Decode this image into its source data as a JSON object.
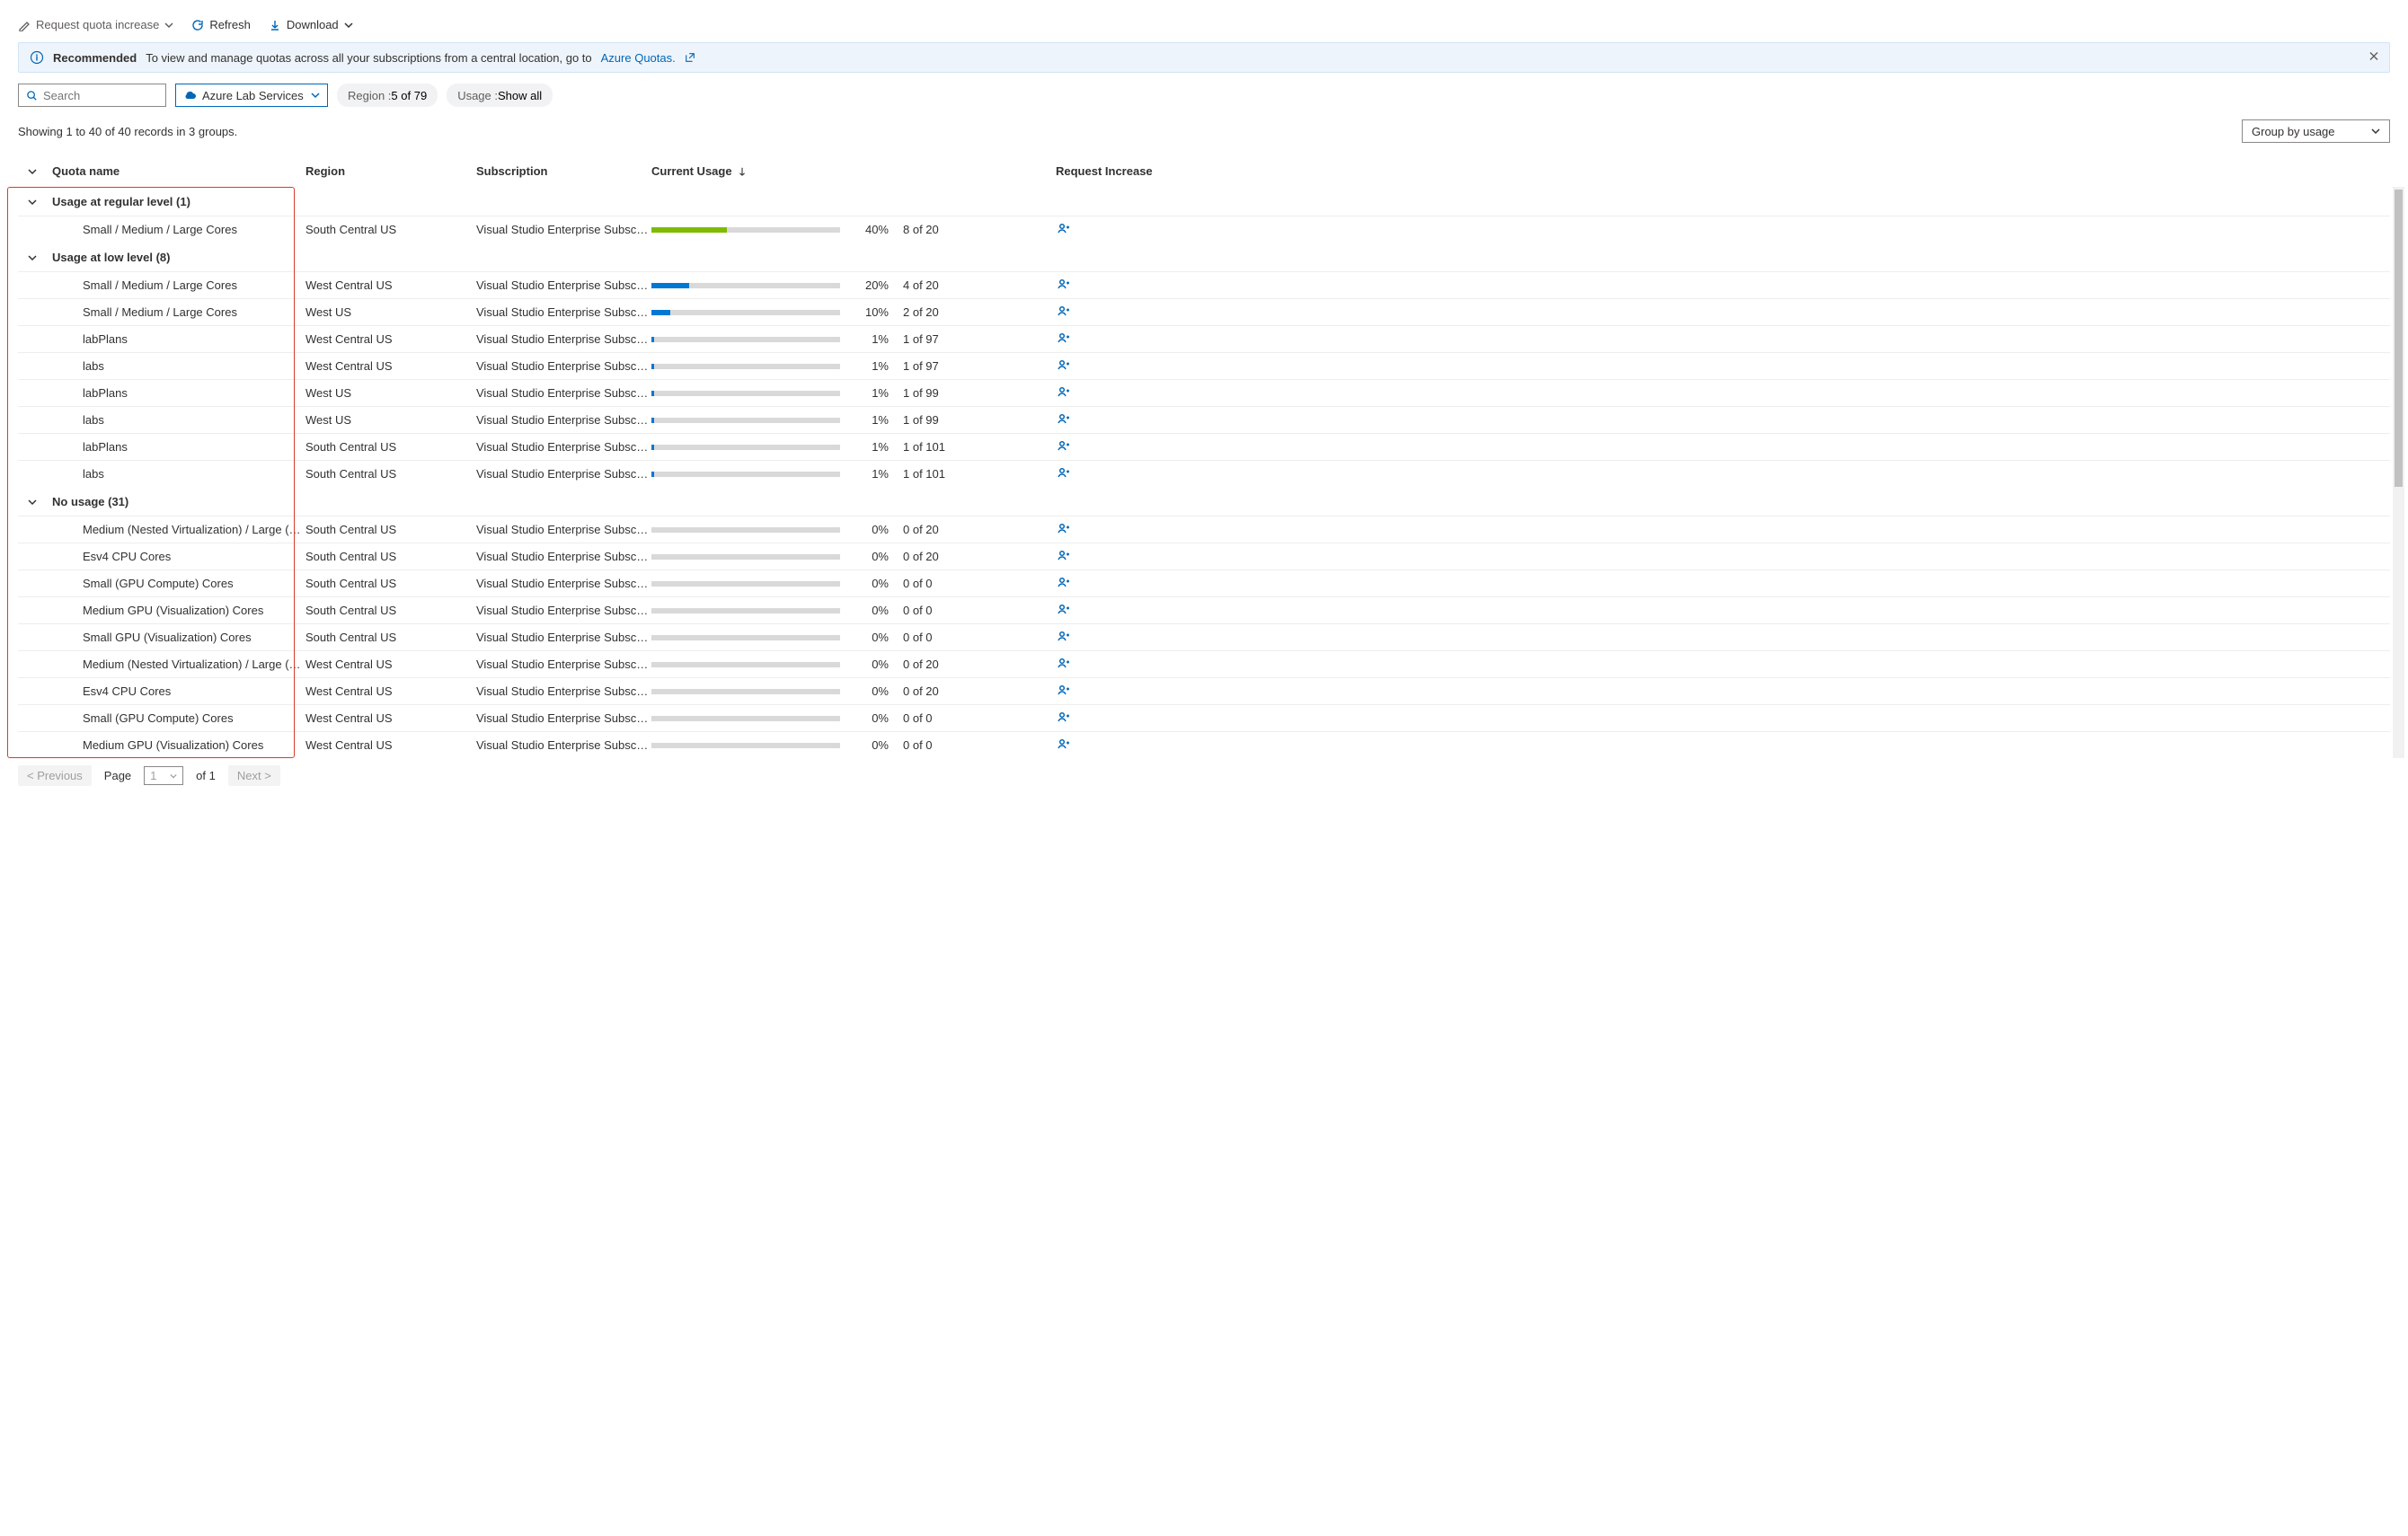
{
  "toolbar": {
    "request_label": "Request quota increase",
    "refresh_label": "Refresh",
    "download_label": "Download"
  },
  "banner": {
    "title": "Recommended",
    "text": "To view and manage quotas across all your subscriptions from a central location, go to ",
    "link_label": "Azure Quotas."
  },
  "filters": {
    "search_placeholder": "Search",
    "provider_label": "Azure Lab Services",
    "region_key": "Region : ",
    "region_val": "5 of 79",
    "usage_key": "Usage : ",
    "usage_val": "Show all"
  },
  "meta": {
    "records_text": "Showing 1 to 40 of 40 records in 3 groups.",
    "group_by_label": "Group by usage"
  },
  "columns": {
    "name": "Quota name",
    "region": "Region",
    "subscription": "Subscription",
    "usage": "Current Usage",
    "request": "Request Increase"
  },
  "groups": [
    {
      "title": "Usage at regular level (1)",
      "rows": [
        {
          "name": "Small / Medium / Large Cores",
          "region": "South Central US",
          "subscription": "Visual Studio Enterprise Subscri…",
          "pct": 40,
          "count": "8 of 20",
          "color": "green"
        }
      ]
    },
    {
      "title": "Usage at low level (8)",
      "rows": [
        {
          "name": "Small / Medium / Large Cores",
          "region": "West Central US",
          "subscription": "Visual Studio Enterprise Subscri…",
          "pct": 20,
          "count": "4 of 20",
          "color": "blue"
        },
        {
          "name": "Small / Medium / Large Cores",
          "region": "West US",
          "subscription": "Visual Studio Enterprise Subscri…",
          "pct": 10,
          "count": "2 of 20",
          "color": "blue"
        },
        {
          "name": "labPlans",
          "region": "West Central US",
          "subscription": "Visual Studio Enterprise Subscri…",
          "pct": 1,
          "count": "1 of 97",
          "color": "sliver"
        },
        {
          "name": "labs",
          "region": "West Central US",
          "subscription": "Visual Studio Enterprise Subscri…",
          "pct": 1,
          "count": "1 of 97",
          "color": "sliver"
        },
        {
          "name": "labPlans",
          "region": "West US",
          "subscription": "Visual Studio Enterprise Subscri…",
          "pct": 1,
          "count": "1 of 99",
          "color": "sliver"
        },
        {
          "name": "labs",
          "region": "West US",
          "subscription": "Visual Studio Enterprise Subscri…",
          "pct": 1,
          "count": "1 of 99",
          "color": "sliver"
        },
        {
          "name": "labPlans",
          "region": "South Central US",
          "subscription": "Visual Studio Enterprise Subscri…",
          "pct": 1,
          "count": "1 of 101",
          "color": "sliver"
        },
        {
          "name": "labs",
          "region": "South Central US",
          "subscription": "Visual Studio Enterprise Subscri…",
          "pct": 1,
          "count": "1 of 101",
          "color": "sliver"
        }
      ]
    },
    {
      "title": "No usage (31)",
      "rows": [
        {
          "name": "Medium (Nested Virtualization) / Large (Nested …",
          "region": "South Central US",
          "subscription": "Visual Studio Enterprise Subscri…",
          "pct": 0,
          "count": "0 of 20",
          "color": "none"
        },
        {
          "name": "Esv4 CPU Cores",
          "region": "South Central US",
          "subscription": "Visual Studio Enterprise Subscri…",
          "pct": 0,
          "count": "0 of 20",
          "color": "none"
        },
        {
          "name": "Small (GPU Compute) Cores",
          "region": "South Central US",
          "subscription": "Visual Studio Enterprise Subscri…",
          "pct": 0,
          "count": "0 of 0",
          "color": "none"
        },
        {
          "name": "Medium GPU (Visualization) Cores",
          "region": "South Central US",
          "subscription": "Visual Studio Enterprise Subscri…",
          "pct": 0,
          "count": "0 of 0",
          "color": "none"
        },
        {
          "name": "Small GPU (Visualization) Cores",
          "region": "South Central US",
          "subscription": "Visual Studio Enterprise Subscri…",
          "pct": 0,
          "count": "0 of 0",
          "color": "none"
        },
        {
          "name": "Medium (Nested Virtualization) / Large (Nested …",
          "region": "West Central US",
          "subscription": "Visual Studio Enterprise Subscri…",
          "pct": 0,
          "count": "0 of 20",
          "color": "none"
        },
        {
          "name": "Esv4 CPU Cores",
          "region": "West Central US",
          "subscription": "Visual Studio Enterprise Subscri…",
          "pct": 0,
          "count": "0 of 20",
          "color": "none"
        },
        {
          "name": "Small (GPU Compute) Cores",
          "region": "West Central US",
          "subscription": "Visual Studio Enterprise Subscri…",
          "pct": 0,
          "count": "0 of 0",
          "color": "none"
        },
        {
          "name": "Medium GPU (Visualization) Cores",
          "region": "West Central US",
          "subscription": "Visual Studio Enterprise Subscri…",
          "pct": 0,
          "count": "0 of 0",
          "color": "none"
        }
      ]
    }
  ],
  "pager": {
    "prev": "< Previous",
    "page_label": "Page",
    "page_value": "1",
    "of_label": "of 1",
    "next": "Next >"
  }
}
